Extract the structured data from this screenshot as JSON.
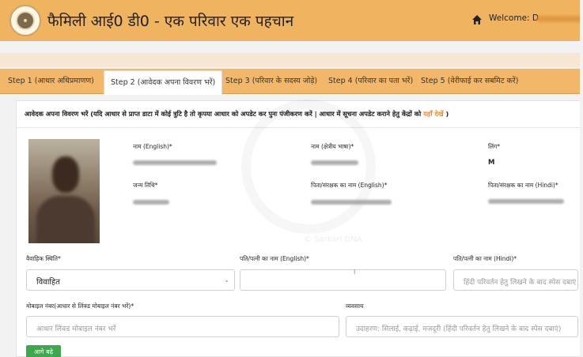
{
  "header": {
    "title": "फैमिली आई0 डी0 - एक परिवार एक पहचान",
    "welcome": "Welcome: D"
  },
  "tabs": [
    {
      "label": "Step 1 (आधार अधिप्रमाणण)"
    },
    {
      "label": "Step 2 (आवेदक अपना विवरण भरें)"
    },
    {
      "label": "Step 3 (परिवार के सदस्य जोड़े)"
    },
    {
      "label": "Step 4 (परिवार का पता भरें)"
    },
    {
      "label": "Step 5 (वेरीफाई कर सबमिट करें)"
    }
  ],
  "panel": {
    "title_prefix": "आवेदक अपना विवरण भरें (यदि आधार से प्राप्त डाटा में कोई त्रुटि है तो कृपया आधार को अपडेट कर पुनः पंजीकरण करें | आधार में सूचना अपडेट कराने हेतु केंद्रों को ",
    "title_link": "यहाँ देखें",
    "title_suffix": " )"
  },
  "watermark": "© Sarkari DNA",
  "details": {
    "name_en_label": "नाम (English)*",
    "name_regional_label": "नाम (क्षेत्रीय भाषा)*",
    "gender_label": "लिंग*",
    "gender_value": "M",
    "dob_label": "जन्म तिथि*",
    "guardian_en_label": "पिता/संरक्षक का नाम (English)*",
    "guardian_hi_label": "पिता/संरक्षक का नाम (Hindi)*"
  },
  "form": {
    "marital_label": "वैवाहिक स्थिति*",
    "marital_value": "विवाहित",
    "spouse_en_label": "पति/पत्नी का नाम (English)*",
    "spouse_hi_label": "पति/पत्नी का नाम (Hindi)*",
    "spouse_hi_placeholder": "हिंदी परिवर्तन हेतु लिखने के बाद स्पेस दबाएं",
    "mobile_label": "मोबाइल नंबर(आधार से लिंक्ड मोबाइल नंबर भरें)*",
    "mobile_placeholder": "आधार लिंक्ड मोबाइल नंबर भरें",
    "occupation_label": "व्यवसाय",
    "occupation_placeholder": "उदाहरण: सिलाई, कढ़ाई, मजदूरी (हिंदी परिवर्तन हेतु लिखने के बाद स्पेस दबाएं)",
    "next_button": "आगे बढ़े"
  }
}
